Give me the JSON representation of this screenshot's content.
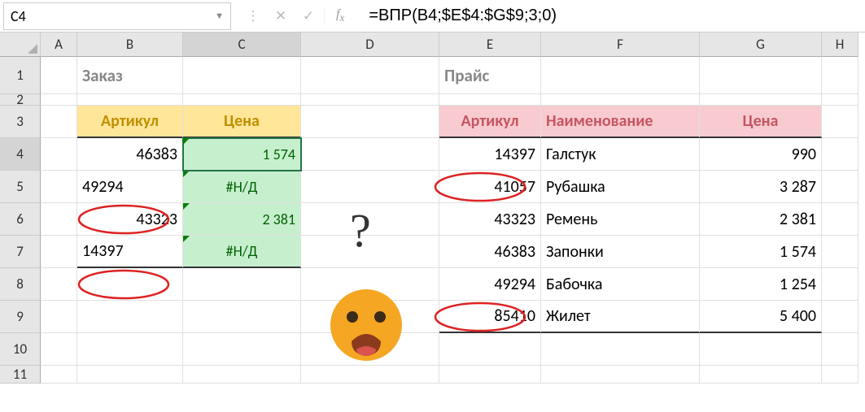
{
  "formula_bar": {
    "cell_ref": "C4",
    "formula": "=ВПР(B4;$E$4:$G$9;3;0)"
  },
  "columns": [
    "A",
    "B",
    "C",
    "D",
    "E",
    "F",
    "G",
    "H"
  ],
  "col_widths": {
    "A": 45,
    "B": 130,
    "C": 145,
    "D": 170,
    "E": 125,
    "F": 195,
    "G": 150,
    "H": 45
  },
  "rows": [
    "1",
    "2",
    "3",
    "4",
    "5",
    "6",
    "7",
    "8",
    "9",
    "10",
    "11"
  ],
  "row_heights": {
    "1": 46,
    "2": 14,
    "3": 40,
    "4": 40,
    "5": 40,
    "6": 40,
    "7": 40,
    "8": 40,
    "9": 40,
    "10": 40,
    "11": 22
  },
  "titles": {
    "order": "Заказ",
    "price": "Прайс"
  },
  "order_headers": {
    "sku": "Артикул",
    "price": "Цена"
  },
  "price_headers": {
    "sku": "Артикул",
    "name": "Наименование",
    "price": "Цена"
  },
  "order_rows": [
    {
      "sku": "46383",
      "price": "1 574"
    },
    {
      "sku": "49294",
      "price": "#Н/Д"
    },
    {
      "sku": "43323",
      "price": "2 381"
    },
    {
      "sku": "14397",
      "price": "#Н/Д"
    }
  ],
  "price_rows": [
    {
      "sku": "14397",
      "name": "Галстук",
      "price": "990"
    },
    {
      "sku": "41057",
      "name": "Рубашка",
      "price": "3 287"
    },
    {
      "sku": "43323",
      "name": "Ремень",
      "price": "2 381"
    },
    {
      "sku": "46383",
      "name": "Запонки",
      "price": "1 574"
    },
    {
      "sku": "49294",
      "name": "Бабочка",
      "price": "1 254"
    },
    {
      "sku": "85410",
      "name": "Жилет",
      "price": "5 400"
    }
  ],
  "overlay": {
    "question": "?"
  }
}
